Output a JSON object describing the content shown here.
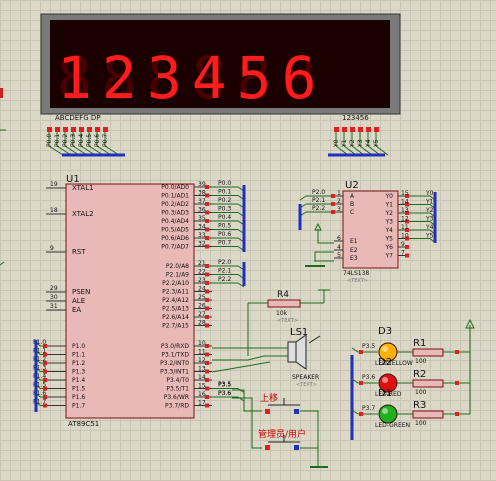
{
  "display": {
    "digits": "123456",
    "segment_label": "ABCDEFG  DP",
    "digit_label": "123456",
    "seg_pins": [
      "P0.0",
      "P0.1",
      "P0.2",
      "P0.3",
      "P0.4",
      "P0.5",
      "P0.6",
      "P0.7"
    ],
    "digit_pins": [
      "Y0",
      "Y1",
      "Y2",
      "Y3",
      "Y4",
      "Y5"
    ]
  },
  "u1": {
    "ref": "U1",
    "part": "AT89C51",
    "left_pins": [
      {
        "num": "19",
        "name": "XTAL1"
      },
      {
        "num": "18",
        "name": "XTAL2"
      },
      {
        "num": "9",
        "name": "RST"
      },
      {
        "num": "29",
        "name": "PSEN"
      },
      {
        "num": "30",
        "name": "ALE"
      },
      {
        "num": "31",
        "name": "EA"
      }
    ],
    "p1_pins": [
      "P1.0",
      "P1.1",
      "P1.2",
      "P1.3",
      "P1.4",
      "P1.5",
      "P1.6",
      "P1.7"
    ],
    "p1_nets": [
      "P1.0",
      "P1.1",
      "P1.2",
      "P1.3",
      "P1.4",
      "P1.5",
      "P1.6",
      "P1.7"
    ],
    "p0_pins": [
      {
        "num": "39",
        "name": "P0.0/AD0",
        "net": "P0.0"
      },
      {
        "num": "38",
        "name": "P0.1/AD1",
        "net": "P0.1"
      },
      {
        "num": "37",
        "name": "P0.2/AD2",
        "net": "P0.2"
      },
      {
        "num": "36",
        "name": "P0.3/AD3",
        "net": "P0.3"
      },
      {
        "num": "35",
        "name": "P0.4/AD4",
        "net": "P0.4"
      },
      {
        "num": "34",
        "name": "P0.5/AD5",
        "net": "P0.5"
      },
      {
        "num": "33",
        "name": "P0.6/AD6",
        "net": "P0.6"
      },
      {
        "num": "32",
        "name": "P0.7/AD7",
        "net": "P0.7"
      }
    ],
    "p2_pins": [
      {
        "num": "21",
        "name": "P2.0/A8",
        "net": "P2.0"
      },
      {
        "num": "22",
        "name": "P2.1/A9",
        "net": "P2.1"
      },
      {
        "num": "23",
        "name": "P2.2/A10",
        "net": "P2.2"
      },
      {
        "num": "24",
        "name": "P2.3/A11",
        "net": ""
      },
      {
        "num": "25",
        "name": "P2.4/A12",
        "net": ""
      },
      {
        "num": "26",
        "name": "P2.5/A13",
        "net": ""
      },
      {
        "num": "27",
        "name": "P2.6/A14",
        "net": ""
      },
      {
        "num": "28",
        "name": "P2.7/A15",
        "net": ""
      }
    ],
    "p3_pins": [
      {
        "num": "10",
        "name": "P3.0/RXD",
        "net": ""
      },
      {
        "num": "11",
        "name": "P3.1/TXD",
        "net": ""
      },
      {
        "num": "12",
        "name": "P3.2/INT0",
        "net": ""
      },
      {
        "num": "13",
        "name": "P3.3/INT1",
        "net": ""
      },
      {
        "num": "14",
        "name": "P3.4/T0",
        "net": ""
      },
      {
        "num": "15",
        "name": "P3.5/T1",
        "net": "P3.5"
      },
      {
        "num": "16",
        "name": "P3.6/WR",
        "net": "P3.6"
      },
      {
        "num": "17",
        "name": "P3.7/RD",
        "net": ""
      }
    ]
  },
  "u2": {
    "ref": "U2",
    "part": "74LS138",
    "text": "<TEXT>",
    "inputs": [
      {
        "num": "1",
        "name": "A",
        "net": "P2.0"
      },
      {
        "num": "2",
        "name": "B",
        "net": "P2.1"
      },
      {
        "num": "3",
        "name": "C",
        "net": "P2.2"
      },
      {
        "num": "6",
        "name": "E1",
        "net": ""
      },
      {
        "num": "4",
        "name": "E2",
        "net": ""
      },
      {
        "num": "5",
        "name": "E3",
        "net": ""
      }
    ],
    "outputs": [
      {
        "num": "15",
        "name": "Y0",
        "net": "Y0"
      },
      {
        "num": "14",
        "name": "Y1",
        "net": "Y1"
      },
      {
        "num": "13",
        "name": "Y2",
        "net": "Y2"
      },
      {
        "num": "12",
        "name": "Y3",
        "net": "Y3"
      },
      {
        "num": "11",
        "name": "Y4",
        "net": "Y4"
      },
      {
        "num": "10",
        "name": "Y5",
        "net": "Y5"
      },
      {
        "num": "9",
        "name": "Y6",
        "net": ""
      },
      {
        "num": "7",
        "name": "Y7",
        "net": ""
      }
    ]
  },
  "r4": {
    "ref": "R4",
    "value": "10k",
    "text": "<TEXT>"
  },
  "ls1": {
    "ref": "LS1",
    "part": "SPEAKER",
    "text": "<TEXT>"
  },
  "buttons": {
    "up": "上移",
    "mode": "管理员/用户",
    "p35": "P3.5",
    "p36": "P3.6"
  },
  "leds": [
    {
      "ref": "D3",
      "part": "LED-YELLOW",
      "net": "P3.5",
      "color": "#ffb000"
    },
    {
      "ref": "D2",
      "part": "LED-RED",
      "net": "P3.6",
      "color": "#e01010"
    },
    {
      "ref": "D1",
      "part": "LED-GREEN",
      "net": "P3.7",
      "color": "#20b020"
    }
  ],
  "resistors": [
    {
      "ref": "R1",
      "value": "100"
    },
    {
      "ref": "R2",
      "value": "100"
    },
    {
      "ref": "R3",
      "value": "100"
    }
  ],
  "colors": {
    "wire": "#1a6b1a",
    "bus": "#1f2fbf",
    "pin_red": "#e02020",
    "chip": "#e9b9b7",
    "chip_border": "#7a1010"
  }
}
